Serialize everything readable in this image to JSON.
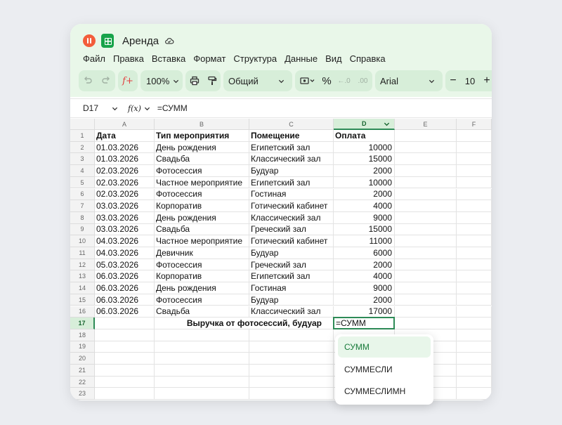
{
  "app": {
    "title": "Аренда",
    "menu": [
      "Файл",
      "Правка",
      "Вставка",
      "Формат",
      "Структура",
      "Данные",
      "Вид",
      "Справка"
    ],
    "toolbar": {
      "zoom": "100%",
      "number_format": "Общий",
      "percent": "%",
      "font": "Arial",
      "font_size": "10",
      "minus": "−",
      "plus": "+"
    },
    "accent_color": "#2e8b57",
    "chrome_color": "#e9f7e9"
  },
  "formula_bar": {
    "cell_ref": "D17",
    "fx_label": "f(x)",
    "formula": "=СУММ"
  },
  "columns": [
    "A",
    "B",
    "C",
    "D",
    "E",
    "F"
  ],
  "rows": [
    "1",
    "2",
    "3",
    "4",
    "5",
    "6",
    "7",
    "8",
    "9",
    "10",
    "11",
    "12",
    "13",
    "14",
    "15",
    "16",
    "17",
    "18",
    "19",
    "20",
    "21",
    "22",
    "23"
  ],
  "table": {
    "header": [
      "Дата",
      "Тип мероприятия",
      "Помещение",
      "Оплата"
    ],
    "rows": [
      [
        "01.03.2026",
        "День рождения",
        "Египетский зал",
        "10000"
      ],
      [
        "01.03.2026",
        "Свадьба",
        "Классический зал",
        "15000"
      ],
      [
        "02.03.2026",
        "Фотосессия",
        "Будуар",
        "2000"
      ],
      [
        "02.03.2026",
        "Частное мероприятие",
        "Египетский зал",
        "10000"
      ],
      [
        "02.03.2026",
        "Фотосессия",
        "Гостиная",
        "2000"
      ],
      [
        "03.03.2026",
        "Корпоратив",
        "Готический кабинет",
        "4000"
      ],
      [
        "03.03.2026",
        "День рождения",
        "Классический зал",
        "9000"
      ],
      [
        "03.03.2026",
        "Свадьба",
        "Греческий зал",
        "15000"
      ],
      [
        "04.03.2026",
        "Частное мероприятие",
        "Готический кабинет",
        "11000"
      ],
      [
        "04.03.2026",
        "Девичник",
        "Будуар",
        "6000"
      ],
      [
        "05.03.2026",
        "Фотосессия",
        "Греческий зал",
        "2000"
      ],
      [
        "06.03.2026",
        "Корпоратив",
        "Египетский зал",
        "4000"
      ],
      [
        "06.03.2026",
        "День рождения",
        "Гостиная",
        "9000"
      ],
      [
        "06.03.2026",
        "Фотосессия",
        "Будуар",
        "2000"
      ],
      [
        "06.03.2026",
        "Свадьба",
        "Классический зал",
        "17000"
      ]
    ],
    "total_label": "Выручка от фотосессий, будуар",
    "total_formula": "=СУММ"
  },
  "autocomplete": [
    "СУММ",
    "СУММЕСЛИ",
    "СУММЕСЛИМН"
  ]
}
